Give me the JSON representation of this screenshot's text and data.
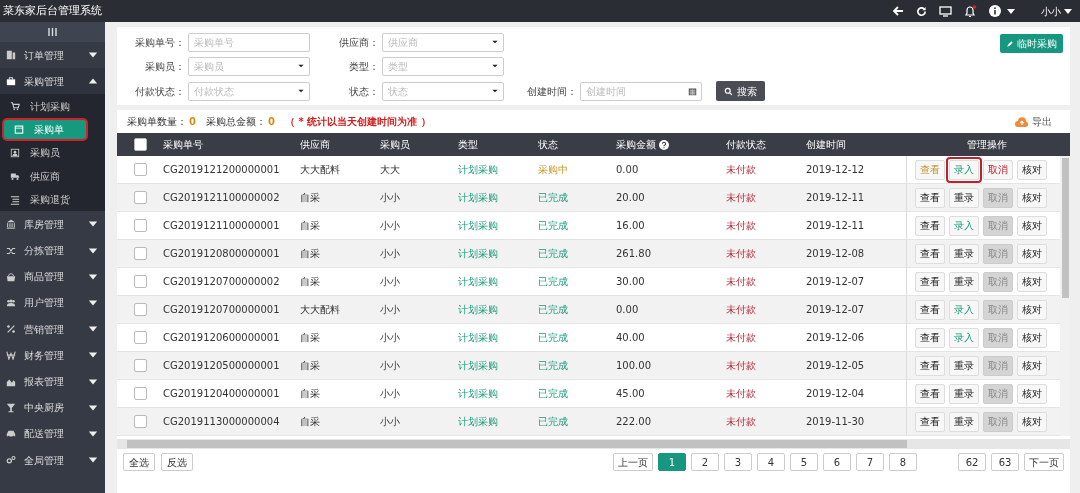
{
  "app_title": "菜东家后台管理系统",
  "user": {
    "name": "小小"
  },
  "sidebar": {
    "items": [
      {
        "label": "订单管理",
        "expanded": false
      },
      {
        "label": "采购管理",
        "expanded": true,
        "children": [
          {
            "label": "计划采购",
            "selected": false,
            "highlighted": false
          },
          {
            "label": "采购单",
            "selected": true,
            "highlighted": true
          },
          {
            "label": "采购员",
            "selected": false,
            "highlighted": false
          },
          {
            "label": "供应商",
            "selected": false,
            "highlighted": false
          },
          {
            "label": "采购退货",
            "selected": false,
            "highlighted": false
          }
        ]
      },
      {
        "label": "库房管理",
        "expanded": false
      },
      {
        "label": "分拣管理",
        "expanded": false
      },
      {
        "label": "商品管理",
        "expanded": false
      },
      {
        "label": "用户管理",
        "expanded": false
      },
      {
        "label": "营销管理",
        "expanded": false
      },
      {
        "label": "财务管理",
        "expanded": false
      },
      {
        "label": "报表管理",
        "expanded": false
      },
      {
        "label": "中央厨房",
        "expanded": false
      },
      {
        "label": "配送管理",
        "expanded": false
      },
      {
        "label": "全局管理",
        "expanded": false
      }
    ]
  },
  "filters": [
    {
      "label": "采购单号：",
      "placeholder": "采购单号",
      "kind": "text"
    },
    {
      "label": "供应商：",
      "placeholder": "供应商",
      "kind": "select"
    },
    {
      "label": "采购员：",
      "placeholder": "采购员",
      "kind": "select"
    },
    {
      "label": "类型：",
      "placeholder": "类型",
      "kind": "select"
    },
    {
      "label": "付款状态：",
      "placeholder": "付款状态",
      "kind": "select"
    },
    {
      "label": "状态：",
      "placeholder": "状态",
      "kind": "select"
    },
    {
      "label": "创建时间：",
      "placeholder": "创建时间",
      "kind": "date"
    }
  ],
  "search_button": "搜索",
  "temp_purchase_button": "临时采购",
  "summary": {
    "count_label": "采购单数量：",
    "count": "0",
    "total_label": "采购总金额：",
    "total": "0",
    "note": "（ * 统计以当天创建时间为准 ）"
  },
  "export_button": "导出",
  "table": {
    "select_all_checked": false,
    "columns": [
      "采购单号",
      "供应商",
      "采购员",
      "类型",
      "状态",
      "采购金额",
      "付款状态",
      "创建时间",
      "管理操作"
    ],
    "rows": [
      {
        "checked": false,
        "id": "CG2019121200000001",
        "supplier": "大大配料",
        "buyer": "大大",
        "type": "计划采购",
        "status": {
          "label": "采购中",
          "kind": "pending"
        },
        "amount": "0.00",
        "pay_status": "未付款",
        "date": "2019-12-12",
        "actions": [
          {
            "label": "查看",
            "kind": "warning",
            "highlighted": false
          },
          {
            "label": "录入",
            "kind": "success",
            "highlighted": true
          },
          {
            "label": "取消",
            "kind": "danger",
            "highlighted": false
          },
          {
            "label": "核对",
            "kind": "default",
            "highlighted": false
          }
        ]
      },
      {
        "checked": false,
        "id": "CG2019121100000002",
        "supplier": "自采",
        "buyer": "小小",
        "type": "计划采购",
        "status": {
          "label": "已完成",
          "kind": "done"
        },
        "amount": "20.00",
        "pay_status": "未付款",
        "date": "2019-12-11",
        "actions": [
          {
            "label": "查看",
            "kind": "default",
            "highlighted": false
          },
          {
            "label": "重录",
            "kind": "default",
            "highlighted": false
          },
          {
            "label": "取消",
            "kind": "disabled",
            "highlighted": false
          },
          {
            "label": "核对",
            "kind": "default",
            "highlighted": false
          }
        ]
      },
      {
        "checked": false,
        "id": "CG2019121100000001",
        "supplier": "自采",
        "buyer": "小小",
        "type": "计划采购",
        "status": {
          "label": "已完成",
          "kind": "done"
        },
        "amount": "16.00",
        "pay_status": "未付款",
        "date": "2019-12-11",
        "actions": [
          {
            "label": "查看",
            "kind": "default",
            "highlighted": false
          },
          {
            "label": "录入",
            "kind": "success",
            "highlighted": false
          },
          {
            "label": "取消",
            "kind": "disabled",
            "highlighted": false
          },
          {
            "label": "核对",
            "kind": "default",
            "highlighted": false
          }
        ]
      },
      {
        "checked": false,
        "id": "CG2019120800000001",
        "supplier": "自采",
        "buyer": "小小",
        "type": "计划采购",
        "status": {
          "label": "已完成",
          "kind": "done"
        },
        "amount": "261.80",
        "pay_status": "未付款",
        "date": "2019-12-08",
        "actions": [
          {
            "label": "查看",
            "kind": "default",
            "highlighted": false
          },
          {
            "label": "重录",
            "kind": "default",
            "highlighted": false
          },
          {
            "label": "取消",
            "kind": "disabled",
            "highlighted": false
          },
          {
            "label": "核对",
            "kind": "default",
            "highlighted": false
          }
        ]
      },
      {
        "checked": false,
        "id": "CG2019120700000002",
        "supplier": "自采",
        "buyer": "小小",
        "type": "计划采购",
        "status": {
          "label": "已完成",
          "kind": "done"
        },
        "amount": "30.00",
        "pay_status": "未付款",
        "date": "2019-12-07",
        "actions": [
          {
            "label": "查看",
            "kind": "default",
            "highlighted": false
          },
          {
            "label": "重录",
            "kind": "default",
            "highlighted": false
          },
          {
            "label": "取消",
            "kind": "disabled",
            "highlighted": false
          },
          {
            "label": "核对",
            "kind": "default",
            "highlighted": false
          }
        ]
      },
      {
        "checked": false,
        "id": "CG2019120700000001",
        "supplier": "大大配料",
        "buyer": "小小",
        "type": "计划采购",
        "status": {
          "label": "已完成",
          "kind": "done"
        },
        "amount": "0.00",
        "pay_status": "未付款",
        "date": "2019-12-07",
        "actions": [
          {
            "label": "查看",
            "kind": "default",
            "highlighted": false
          },
          {
            "label": "录入",
            "kind": "success",
            "highlighted": false
          },
          {
            "label": "取消",
            "kind": "disabled",
            "highlighted": false
          },
          {
            "label": "核对",
            "kind": "default",
            "highlighted": false
          }
        ]
      },
      {
        "checked": false,
        "id": "CG2019120600000001",
        "supplier": "自采",
        "buyer": "小小",
        "type": "计划采购",
        "status": {
          "label": "已完成",
          "kind": "done"
        },
        "amount": "40.00",
        "pay_status": "未付款",
        "date": "2019-12-06",
        "actions": [
          {
            "label": "查看",
            "kind": "default",
            "highlighted": false
          },
          {
            "label": "录入",
            "kind": "success",
            "highlighted": false
          },
          {
            "label": "取消",
            "kind": "disabled",
            "highlighted": false
          },
          {
            "label": "核对",
            "kind": "default",
            "highlighted": false
          }
        ]
      },
      {
        "checked": false,
        "id": "CG2019120500000001",
        "supplier": "自采",
        "buyer": "小小",
        "type": "计划采购",
        "status": {
          "label": "已完成",
          "kind": "done"
        },
        "amount": "100.00",
        "pay_status": "未付款",
        "date": "2019-12-05",
        "actions": [
          {
            "label": "查看",
            "kind": "default",
            "highlighted": false
          },
          {
            "label": "重录",
            "kind": "default",
            "highlighted": false
          },
          {
            "label": "取消",
            "kind": "disabled",
            "highlighted": false
          },
          {
            "label": "核对",
            "kind": "default",
            "highlighted": false
          }
        ]
      },
      {
        "checked": false,
        "id": "CG2019120400000001",
        "supplier": "自采",
        "buyer": "小小",
        "type": "计划采购",
        "status": {
          "label": "已完成",
          "kind": "done"
        },
        "amount": "45.00",
        "pay_status": "未付款",
        "date": "2019-12-04",
        "actions": [
          {
            "label": "查看",
            "kind": "default",
            "highlighted": false
          },
          {
            "label": "重录",
            "kind": "default",
            "highlighted": false
          },
          {
            "label": "取消",
            "kind": "disabled",
            "highlighted": false
          },
          {
            "label": "核对",
            "kind": "default",
            "highlighted": false
          }
        ]
      },
      {
        "checked": false,
        "id": "CG2019113000000004",
        "supplier": "自采",
        "buyer": "小小",
        "type": "计划采购",
        "status": {
          "label": "已完成",
          "kind": "done"
        },
        "amount": "222.00",
        "pay_status": "未付款",
        "date": "2019-11-30",
        "actions": [
          {
            "label": "查看",
            "kind": "default",
            "highlighted": false
          },
          {
            "label": "重录",
            "kind": "default",
            "highlighted": false
          },
          {
            "label": "取消",
            "kind": "disabled",
            "highlighted": false
          },
          {
            "label": "核对",
            "kind": "default",
            "highlighted": false
          }
        ]
      }
    ]
  },
  "bulk_buttons": [
    "全选",
    "反选"
  ],
  "pagination": [
    {
      "label": "上一页",
      "selected": false
    },
    {
      "label": "1",
      "selected": true
    },
    {
      "label": "2",
      "selected": false
    },
    {
      "label": "3",
      "selected": false
    },
    {
      "label": "4",
      "selected": false
    },
    {
      "label": "5",
      "selected": false
    },
    {
      "label": "6",
      "selected": false
    },
    {
      "label": "7",
      "selected": false
    },
    {
      "label": "8",
      "selected": false
    },
    {
      "label": "62",
      "selected": false
    },
    {
      "label": "63",
      "selected": false
    },
    {
      "label": "下一页",
      "selected": false
    }
  ]
}
